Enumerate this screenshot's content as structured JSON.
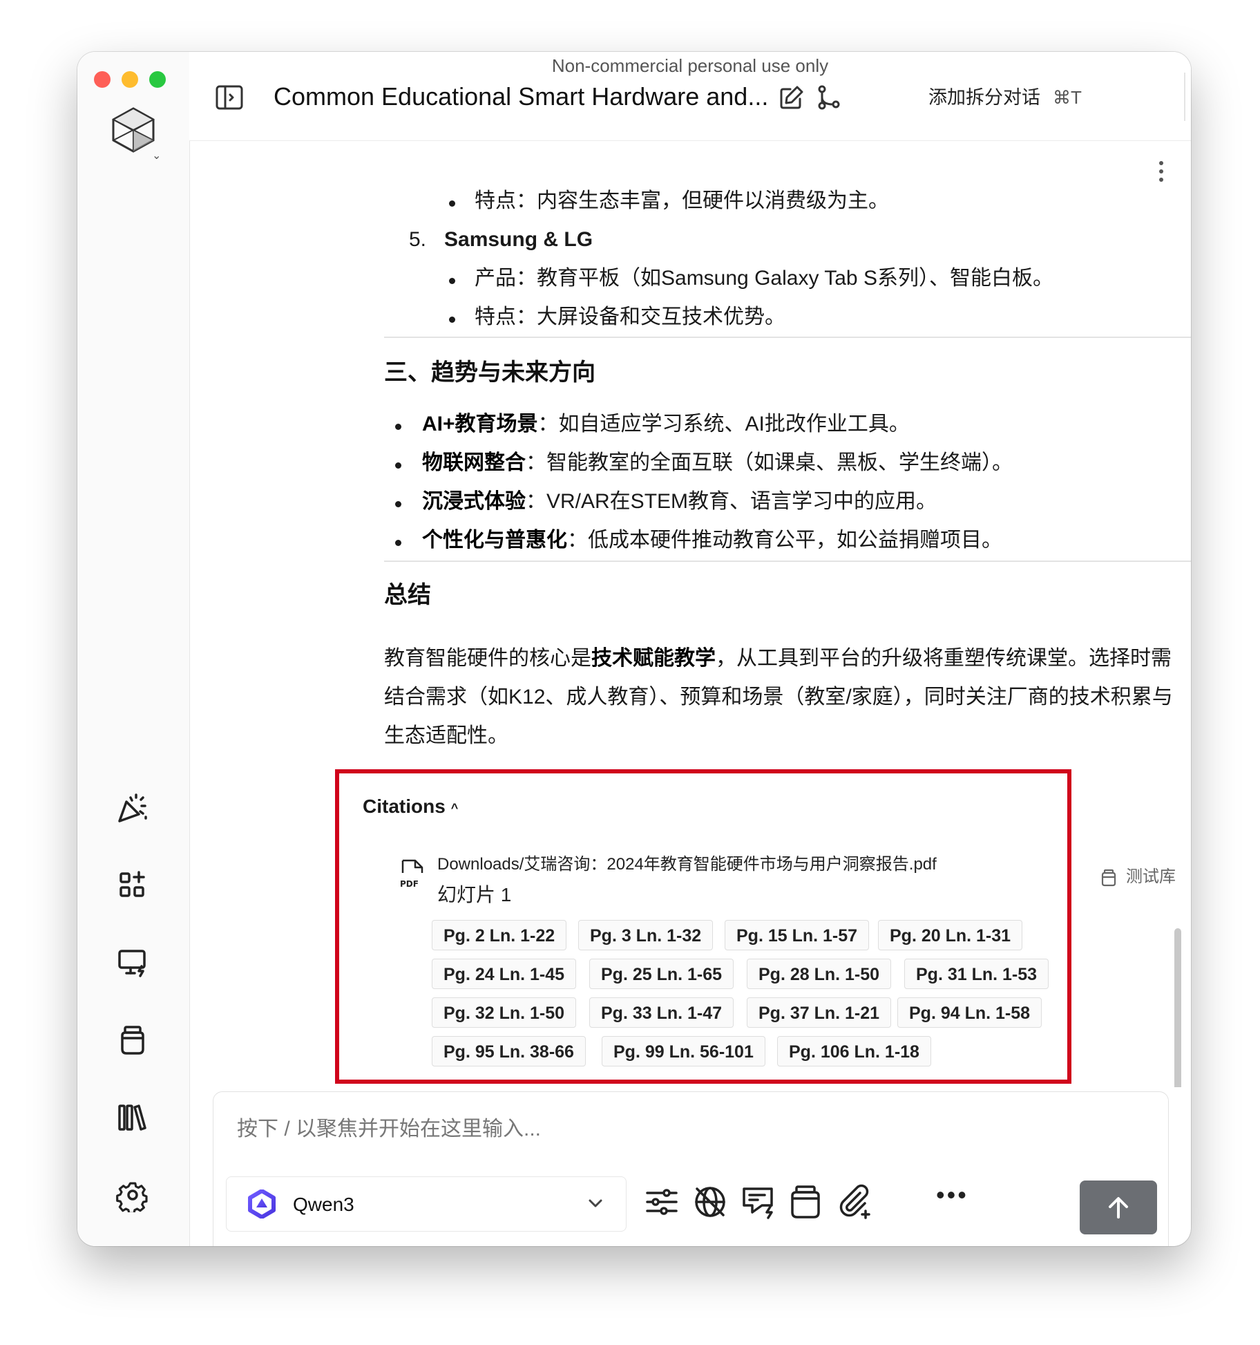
{
  "watermark": "Non-commercial personal use only",
  "header": {
    "title": "Common Educational Smart Hardware and...",
    "split_label": "添加拆分对话",
    "split_shortcut": "⌘T"
  },
  "content": {
    "list_top_item": "特点：内容生态丰富，但硬件以消费级为主。",
    "item5_number": "5.",
    "item5_title": "Samsung & LG",
    "item5_product": "产品：教育平板（如Samsung Galaxy Tab S系列）、智能白板。",
    "item5_feature": "特点：大屏设备和交互技术优势。",
    "section3_title": "三、趋势与未来方向",
    "trends": [
      {
        "label": "AI+教育场景",
        "text": "：如自适应学习系统、AI批改作业工具。"
      },
      {
        "label": "物联网整合",
        "text": "：智能教室的全面互联（如课桌、黑板、学生终端）。"
      },
      {
        "label": "沉浸式体验",
        "text": "：VR/AR在STEM教育、语言学习中的应用。"
      },
      {
        "label": "个性化与普惠化",
        "text": "：低成本硬件推动教育公平，如公益捐赠项目。"
      }
    ],
    "summary_title": "总结",
    "summary_l1_a": "教育智能硬件的核心是",
    "summary_l1_bold": "技术赋能教学",
    "summary_l1_b": "，从工具到平台的升级将重塑传统课堂。选择时需",
    "summary_l2": "结合需求（如K12、成人教育）、预算和场景（教室/家庭），同时关注厂商的技术积累与",
    "summary_l3": "生态适配性。"
  },
  "citations": {
    "header": "Citations",
    "file": "Downloads/艾瑞咨询：2024年教育智能硬件市场与用户洞察报告.pdf",
    "slide": "幻灯片 1",
    "chips": [
      "Pg. 2   Ln. 1-22",
      "Pg. 3   Ln. 1-32",
      "Pg. 15   Ln. 1-57",
      "Pg. 20   Ln. 1-31",
      "Pg. 24   Ln. 1-45",
      "Pg. 25   Ln. 1-65",
      "Pg. 28   Ln. 1-50",
      "Pg. 31   Ln. 1-53",
      "Pg. 32   Ln. 1-50",
      "Pg. 33   Ln. 1-47",
      "Pg. 37   Ln. 1-21",
      "Pg. 94   Ln. 1-58",
      "Pg. 95   Ln. 38-66",
      "Pg. 99   Ln. 56-101",
      "Pg. 106   Ln. 1-18"
    ],
    "library_tag": "测试库"
  },
  "composer": {
    "placeholder": "按下 / 以聚焦并开始在这里输入...",
    "model": "Qwen3"
  },
  "colors": {
    "highlight_border": "#d0021b",
    "send_button": "#6b6e73"
  }
}
